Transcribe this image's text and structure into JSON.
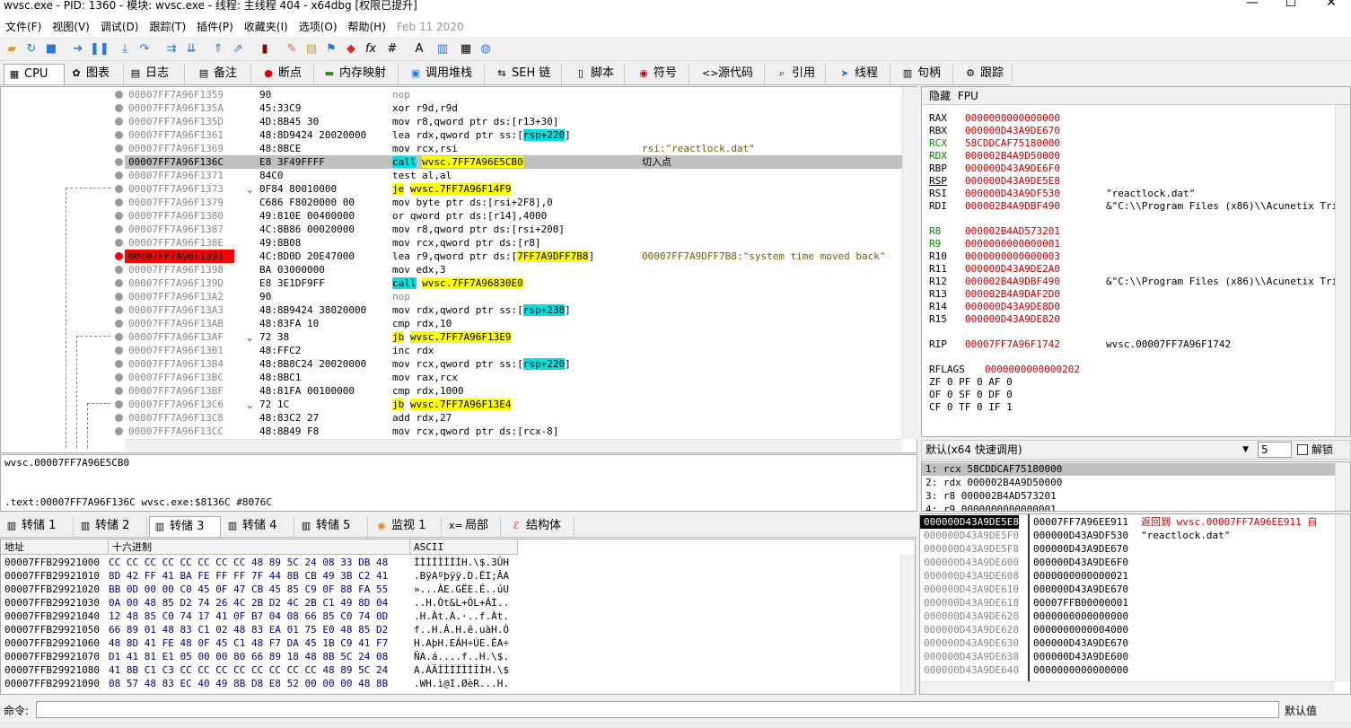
{
  "window": {
    "title": "wvsc.exe - PID: 1360 - 模块: wvsc.exe - 线程: 主线程 404 - x64dbg [权限已提升]",
    "min": "—",
    "max": "☐",
    "close": "✕"
  },
  "menu": [
    "文件(F)",
    "视图(V)",
    "调试(D)",
    "跟踪(T)",
    "插件(P)",
    "收藏夹(I)",
    "选项(O)",
    "帮助(H)"
  ],
  "menu_date": "Feb 11 2020",
  "tabs": [
    {
      "label": "CPU",
      "icon": "▦"
    },
    {
      "label": "图表",
      "icon": "✿"
    },
    {
      "label": "日志",
      "icon": "▤"
    },
    {
      "label": "备注",
      "icon": "▤"
    },
    {
      "label": "断点",
      "icon": "●"
    },
    {
      "label": "内存映射",
      "icon": "▬"
    },
    {
      "label": "调用堆栈",
      "icon": "▣"
    },
    {
      "label": "SEH 链",
      "icon": "⇆"
    },
    {
      "label": "脚本",
      "icon": "▯"
    },
    {
      "label": "符号",
      "icon": "◉"
    },
    {
      "label": "源代码",
      "icon": "<>"
    },
    {
      "label": "引用",
      "icon": "⌕"
    },
    {
      "label": "线程",
      "icon": "➤"
    },
    {
      "label": "句柄",
      "icon": "▥"
    },
    {
      "label": "跟踪",
      "icon": "⚙"
    }
  ],
  "disasm": [
    {
      "addr": "00007FF7A96F1359",
      "hex": "90",
      "ins": "nop",
      "cmt": ""
    },
    {
      "addr": "00007FF7A96F135A",
      "hex": "45:33C9",
      "ins": "xor r9d,r9d",
      "cmt": ""
    },
    {
      "addr": "00007FF7A96F135D",
      "hex": "4D:8B45 30",
      "ins": "mov r8,qword ptr ds:[r13+30]",
      "cmt": ""
    },
    {
      "addr": "00007FF7A96F1361",
      "hex": "48:8D9424 20020000",
      "ins": "lea rdx,qword ptr ss:[rsp+220]",
      "cmt": ""
    },
    {
      "addr": "00007FF7A96F1369",
      "hex": "48:8BCE",
      "ins": "mov rcx,rsi",
      "cmt": "rsi:\"reactlock.dat\""
    },
    {
      "addr": "00007FF7A96F136C",
      "hex": "E8 3F49FFFF",
      "ins": "call wvsc.7FF7A96E5CB0",
      "cmt": "切入点"
    },
    {
      "addr": "00007FF7A96F1371",
      "hex": "84C0",
      "ins": "test al,al",
      "cmt": ""
    },
    {
      "addr": "00007FF7A96F1373",
      "hex": "0F84 80010000",
      "ins": "je wvsc.7FF7A96F14F9",
      "cmt": ""
    },
    {
      "addr": "00007FF7A96F1379",
      "hex": "C686 F8020000 00",
      "ins": "mov byte ptr ds:[rsi+2F8],0",
      "cmt": ""
    },
    {
      "addr": "00007FF7A96F1380",
      "hex": "49:810E 00400000",
      "ins": "or qword ptr ds:[r14],4000",
      "cmt": ""
    },
    {
      "addr": "00007FF7A96F1387",
      "hex": "4C:8B86 00020000",
      "ins": "mov r8,qword ptr ds:[rsi+200]",
      "cmt": ""
    },
    {
      "addr": "00007FF7A96F138E",
      "hex": "49:8B08",
      "ins": "mov rcx,qword ptr ds:[r8]",
      "cmt": ""
    },
    {
      "addr": "00007FF7A96F1391",
      "hex": "4C:8D0D 20E47000",
      "ins": "lea r9,qword ptr ds:[7FF7A9DFF7B8]",
      "cmt": "00007FF7A9DFF7B8:\"system time moved back\""
    },
    {
      "addr": "00007FF7A96F1398",
      "hex": "BA 03000000",
      "ins": "mov edx,3",
      "cmt": ""
    },
    {
      "addr": "00007FF7A96F139D",
      "hex": "E8 3E1DF9FF",
      "ins": "call wvsc.7FF7A96830E0",
      "cmt": ""
    },
    {
      "addr": "00007FF7A96F13A2",
      "hex": "90",
      "ins": "nop",
      "cmt": ""
    },
    {
      "addr": "00007FF7A96F13A3",
      "hex": "48:8B9424 38020000",
      "ins": "mov rdx,qword ptr ss:[rsp+238]",
      "cmt": ""
    },
    {
      "addr": "00007FF7A96F13AB",
      "hex": "48:83FA 10",
      "ins": "cmp rdx,10",
      "cmt": ""
    },
    {
      "addr": "00007FF7A96F13AF",
      "hex": "72 38",
      "ins": "jb wvsc.7FF7A96F13E9",
      "cmt": ""
    },
    {
      "addr": "00007FF7A96F13B1",
      "hex": "48:FFC2",
      "ins": "inc rdx",
      "cmt": ""
    },
    {
      "addr": "00007FF7A96F13B4",
      "hex": "48:8B8C24 20020000",
      "ins": "mov rcx,qword ptr ss:[rsp+220]",
      "cmt": ""
    },
    {
      "addr": "00007FF7A96F13BC",
      "hex": "48:8BC1",
      "ins": "mov rax,rcx",
      "cmt": ""
    },
    {
      "addr": "00007FF7A96F13BF",
      "hex": "48:81FA 00100000",
      "ins": "cmp rdx,1000",
      "cmt": ""
    },
    {
      "addr": "00007FF7A96F13C6",
      "hex": "72 1C",
      "ins": "jb wvsc.7FF7A96F13E4",
      "cmt": ""
    },
    {
      "addr": "00007FF7A96F13C8",
      "hex": "48:83C2 27",
      "ins": "add rdx,27",
      "cmt": ""
    },
    {
      "addr": "00007FF7A96F13CC",
      "hex": "48:8B49 F8",
      "ins": "mov rcx,qword ptr ds:[rcx-8]",
      "cmt": ""
    }
  ],
  "regs_header": {
    "hide": "隐藏",
    "fpu": "FPU"
  },
  "regs": [
    {
      "n": "RAX",
      "v": "0000000000000000",
      "d": ""
    },
    {
      "n": "RBX",
      "v": "000000D43A9DE670",
      "d": ""
    },
    {
      "n": "RCX",
      "v": "58CDDCAF75180000",
      "d": ""
    },
    {
      "n": "RDX",
      "v": "000002B4A9D50000",
      "d": ""
    },
    {
      "n": "RBP",
      "v": "000000D43A9DE6F0",
      "d": ""
    },
    {
      "n": "RSP",
      "v": "000000D43A9DE5E8",
      "d": ""
    },
    {
      "n": "RSI",
      "v": "000000D43A9DF530",
      "d": "\"reactlock.dat\""
    },
    {
      "n": "RDI",
      "v": "000002B4A9DBF490",
      "d": "&\"C:\\\\Program Files (x86)\\\\Acunetix Tria"
    },
    {
      "n": "R8",
      "v": "000002B4AD573201",
      "d": ""
    },
    {
      "n": "R9",
      "v": "0000000000000001",
      "d": ""
    },
    {
      "n": "R10",
      "v": "0000000000000003",
      "d": ""
    },
    {
      "n": "R11",
      "v": "000000D43A9DE2A0",
      "d": ""
    },
    {
      "n": "R12",
      "v": "000002B4A9DBF490",
      "d": "&\"C:\\\\Program Files (x86)\\\\Acunetix Tria"
    },
    {
      "n": "R13",
      "v": "000002B4A9DAF2D0",
      "d": ""
    },
    {
      "n": "R14",
      "v": "000000D43A9DE8D0",
      "d": ""
    },
    {
      "n": "R15",
      "v": "000000D43A9DE820",
      "d": ""
    },
    {
      "n": "RIP",
      "v": "00007FF7A96F1742",
      "d": "wvsc.00007FF7A96F1742"
    },
    {
      "n": "RFLAGS",
      "v": "0000000000000202",
      "d": ""
    }
  ],
  "flags": [
    "ZF 0  PF 0  AF 0",
    "OF 0  SF 0  DF 0",
    "CF 0  TF 0  IF 1"
  ],
  "callconv": {
    "label": "默认(x64 快速调用)",
    "count": "5",
    "unlock": "解锁"
  },
  "callargs": [
    "1: rcx 58CDDCAF75180000",
    "2: rdx 000002B4A9D50000",
    "3: r8 000002B4AD573201",
    "4: r9 0000000000000001"
  ],
  "info": {
    "line1": "wvsc.00007FF7A96E5CB0",
    "line2": ".text:00007FF7A96F136C wvsc.exe:$8136C #8076C"
  },
  "dump_tabs": [
    "转储 1",
    "转储 2",
    "转储 3",
    "转储 4",
    "转储 5",
    "监视 1",
    "局部",
    "结构体"
  ],
  "dump_headers": {
    "addr": "地址",
    "hex": "十六进制",
    "ascii": "ASCII"
  },
  "dump": [
    {
      "a": "00007FFB29921000",
      "h": "CC CC CC CC CC CC CC CC 48 89 5C 24 08 33 DB 48",
      "s": "ÌÌÌÌÌÌÌÌH.\\$.3ÛH"
    },
    {
      "a": "00007FFB29921010",
      "h": "8D 42 FF 41 BA FE FF FF 7F 44 8B CB 49 3B C2 41",
      "s": ".BÿAºþÿÿ.D.ËI;ÂA"
    },
    {
      "a": "00007FFB29921020",
      "h": "BB 0D 00 00 C0 45 0F 47 CB 45 85 C9 0F 88 FA 55",
      "s": "»...ÀE.GËE.É..úU"
    },
    {
      "a": "00007FFB29921030",
      "h": "0A 00 48 85 D2 74 26 4C 2B D2 4C 2B C1 49 8D 04",
      "s": "..H.Òt&L+ÒL+ÁI.."
    },
    {
      "a": "00007FFB29921040",
      "h": "12 48 85 C0 74 17 41 0F B7 04 08 66 85 C0 74 0D",
      "s": ".H.Àt.A.·..f.Àt."
    },
    {
      "a": "00007FFB29921050",
      "h": "66 89 01 48 83 C1 02 48 83 EA 01 75 E0 48 85 D2",
      "s": "f..H.Á.H.ê.uàH.Ò"
    },
    {
      "a": "00007FFB29921060",
      "h": "48 8D 41 FE 48 0F 45 C1 48 F7 DA 45 1B C9 41 F7",
      "s": "H.AþH.EÁH÷ÚE.ÉA÷"
    },
    {
      "a": "00007FFB29921070",
      "h": "D1 41 81 E1 05 00 00 80 66 89 18 48 8B 5C 24 08",
      "s": "ÑA.á....f..H.\\$."
    },
    {
      "a": "00007FFB29921080",
      "h": "41 8B C1 C3 CC CC CC CC CC CC CC CC 48 89 5C 24",
      "s": "A.ÁÃÌÌÌÌÌÌÌÌH.\\$"
    },
    {
      "a": "00007FFB29921090",
      "h": "08 57 48 83 EC 40 49 8B D8 E8 52 00 00 00 48 8B",
      "s": ".WH.ì@I.ØèR...H."
    }
  ],
  "stack": [
    {
      "a": "000000D43A9DE5E8",
      "v": "00007FF7A96EE911",
      "c": "返回到 wvsc.00007FF7A96EE911 自"
    },
    {
      "a": "000000D43A9DE5F0",
      "v": "000000D43A9DF530",
      "c": "\"reactlock.dat\""
    },
    {
      "a": "000000D43A9DE5F8",
      "v": "000000D43A9DE670",
      "c": ""
    },
    {
      "a": "000000D43A9DE600",
      "v": "000000D43A9DE6F0",
      "c": ""
    },
    {
      "a": "000000D43A9DE608",
      "v": "0000000000000021",
      "c": ""
    },
    {
      "a": "000000D43A9DE610",
      "v": "000000D43A9DE670",
      "c": ""
    },
    {
      "a": "000000D43A9DE618",
      "v": "00007FFB00000001",
      "c": ""
    },
    {
      "a": "000000D43A9DE620",
      "v": "0000000000000000",
      "c": ""
    },
    {
      "a": "000000D43A9DE628",
      "v": "0000000000004000",
      "c": ""
    },
    {
      "a": "000000D43A9DE630",
      "v": "000000D43A9DE670",
      "c": ""
    },
    {
      "a": "000000D43A9DE638",
      "v": "000000D43A9DE600",
      "c": ""
    },
    {
      "a": "000000D43A9DE640",
      "v": "0000000000000000",
      "c": ""
    }
  ],
  "cmd": {
    "label": "命令:",
    "value": "",
    "default": "默认值"
  }
}
